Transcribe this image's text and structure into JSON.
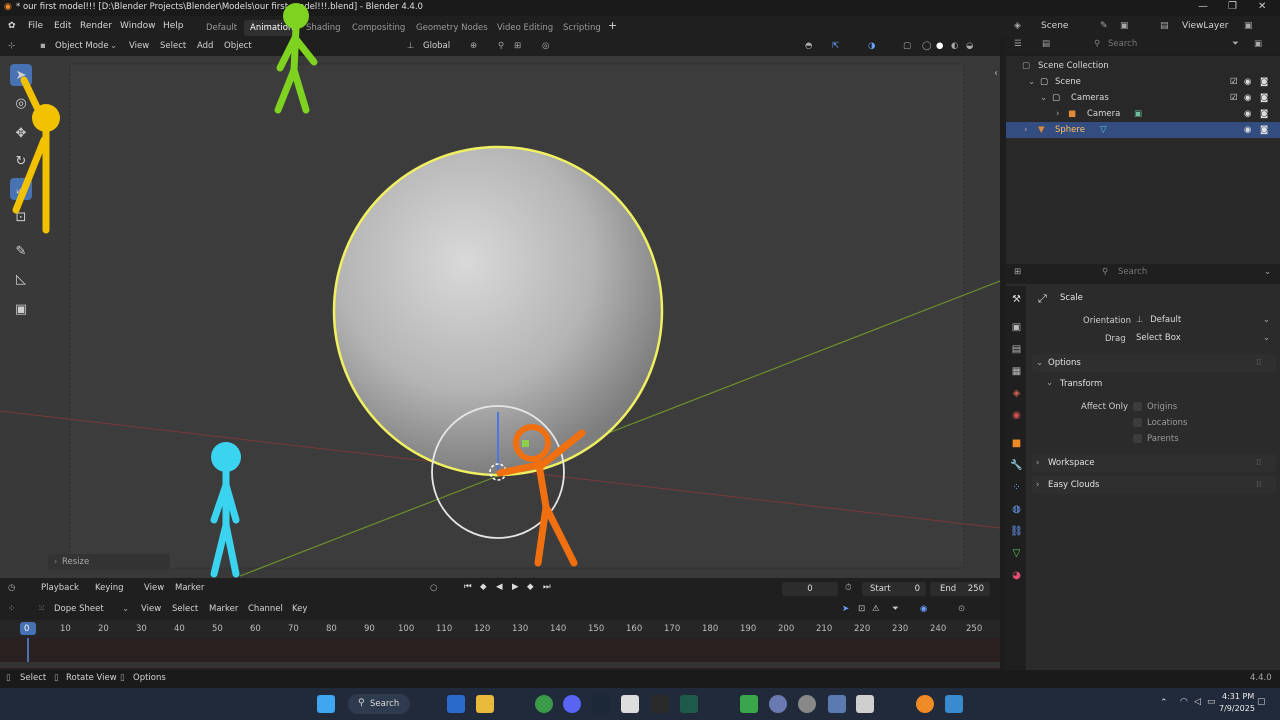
{
  "window": {
    "title": "* our first model!!! [D:\\Blender Projects\\Blender\\Models\\our first model!!!.blend] - Blender 4.4.0",
    "minimize": "—",
    "maximize": "❐",
    "close": "✕"
  },
  "menubar": {
    "items": [
      "File",
      "Edit",
      "Render",
      "Window",
      "Help"
    ],
    "workspaces": [
      "Default",
      "Animation",
      "Shading",
      "Compositing",
      "Geometry Nodes",
      "Video Editing",
      "Scripting"
    ],
    "active_workspace": "Animation",
    "add_workspace": "+",
    "scene_label": "Scene",
    "viewlayer_label": "ViewLayer"
  },
  "viewport_header": {
    "mode": "Object Mode",
    "menus": [
      "View",
      "Select",
      "Add",
      "Object"
    ],
    "orientation": "Global"
  },
  "viewport": {
    "operator_panel": "Resize"
  },
  "outliner": {
    "search_placeholder": "Search",
    "rows": [
      {
        "label": "Scene Collection"
      },
      {
        "label": "Scene"
      },
      {
        "label": "Cameras"
      },
      {
        "label": "Camera"
      },
      {
        "label": "Sphere"
      }
    ]
  },
  "properties": {
    "search_placeholder": "Search",
    "tool_name": "Scale",
    "orientation_label": "Orientation",
    "orientation_value": "Default",
    "drag_label": "Drag",
    "drag_value": "Select Box",
    "options_panel": "Options",
    "transform_subpanel": "Transform",
    "affect_only_label": "Affect Only",
    "affect_options": [
      "Origins",
      "Locations",
      "Parents"
    ],
    "workspace_panel": "Workspace",
    "easy_clouds_panel": "Easy Clouds"
  },
  "timeline": {
    "menus": [
      "Playback",
      "Keying",
      "View",
      "Marker"
    ],
    "current_frame": "0",
    "start_label": "Start",
    "start_value": "0",
    "end_label": "End",
    "end_value": "250"
  },
  "dopesheet": {
    "mode": "Dope Sheet",
    "menus": [
      "View",
      "Select",
      "Marker",
      "Channel",
      "Key"
    ],
    "frames": [
      "0",
      "10",
      "20",
      "30",
      "40",
      "50",
      "60",
      "70",
      "80",
      "90",
      "100",
      "110",
      "120",
      "130",
      "140",
      "150",
      "160",
      "170",
      "180",
      "190",
      "200",
      "210",
      "220",
      "230",
      "240",
      "250"
    ]
  },
  "statusbar": {
    "select": "Select",
    "rotate_view": "Rotate View",
    "options": "Options",
    "version": "4.4.0"
  },
  "taskbar": {
    "search": "Search",
    "time": "4:31 PM",
    "date": "7/9/2025"
  },
  "colors": {
    "accent": "#4772b3",
    "selection_outline": "#f0f060",
    "stick_green": "#7ed321",
    "stick_yellow": "#f2c200",
    "stick_blue": "#3ad4f0",
    "stick_orange": "#f07010"
  }
}
